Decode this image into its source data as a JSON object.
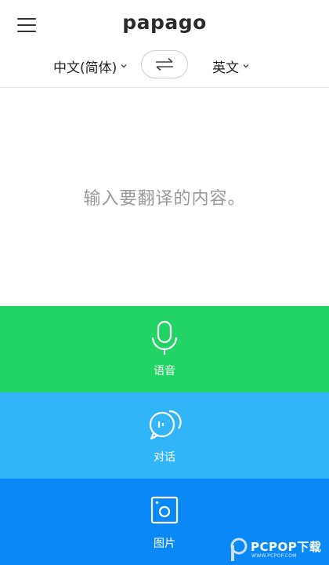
{
  "header": {
    "logo_text": "papago"
  },
  "language_bar": {
    "source_language": "中文(简体)",
    "target_language": "英文"
  },
  "input": {
    "placeholder": "输入要翻译的内容。"
  },
  "actions": [
    {
      "label": "语音",
      "icon": "microphone-icon",
      "color": "#22d366"
    },
    {
      "label": "对话",
      "icon": "conversation-icon",
      "color": "#31b5f8"
    },
    {
      "label": "图片",
      "icon": "image-icon",
      "color": "#0a88f6"
    }
  ],
  "watermark": {
    "text": "PCPOP下载",
    "subtext": "WWW.PCPOP.COM"
  },
  "colors": {
    "voice": "#22d366",
    "conversation": "#31b5f8",
    "image": "#0a88f6",
    "text_dark": "#222222",
    "placeholder": "#9a9a9a"
  }
}
